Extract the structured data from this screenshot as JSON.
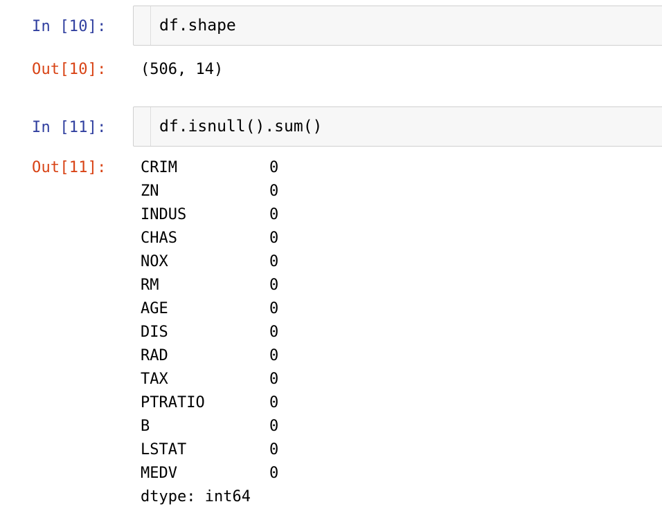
{
  "cells": [
    {
      "in_prompt": "In [10]:",
      "code": "df.shape",
      "out_prompt": "Out[10]:",
      "output": "(506, 14)"
    },
    {
      "in_prompt": "In [11]:",
      "code": "df.isnull().sum()",
      "out_prompt": "Out[11]:",
      "series": [
        {
          "name": "CRIM",
          "value": "0"
        },
        {
          "name": "ZN",
          "value": "0"
        },
        {
          "name": "INDUS",
          "value": "0"
        },
        {
          "name": "CHAS",
          "value": "0"
        },
        {
          "name": "NOX",
          "value": "0"
        },
        {
          "name": "RM",
          "value": "0"
        },
        {
          "name": "AGE",
          "value": "0"
        },
        {
          "name": "DIS",
          "value": "0"
        },
        {
          "name": "RAD",
          "value": "0"
        },
        {
          "name": "TAX",
          "value": "0"
        },
        {
          "name": "PTRATIO",
          "value": "0"
        },
        {
          "name": "B",
          "value": "0"
        },
        {
          "name": "LSTAT",
          "value": "0"
        },
        {
          "name": "MEDV",
          "value": "0"
        }
      ],
      "dtype": "dtype: int64"
    }
  ],
  "colors": {
    "in_prompt": "#303f9f",
    "out_prompt": "#d84315",
    "input_bg": "#f7f7f7",
    "input_border": "#cfcfcf"
  }
}
